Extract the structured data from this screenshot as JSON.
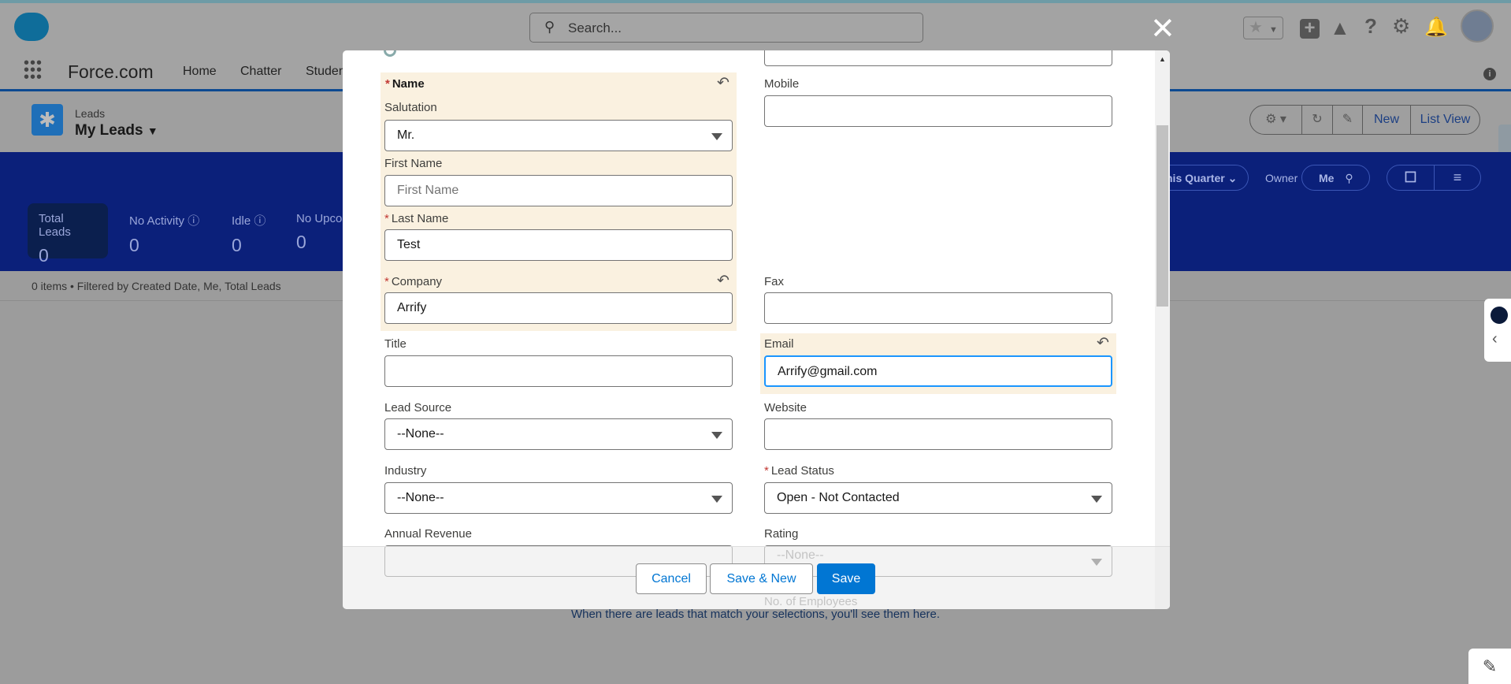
{
  "header": {
    "search_placeholder": "Search...",
    "app_name": "Force.com",
    "nav": [
      "Home",
      "Chatter",
      "Studen"
    ]
  },
  "page": {
    "object": "Leads",
    "list_view": "My Leads",
    "toolbar": {
      "new": "New",
      "list_view": "List View"
    }
  },
  "filters": {
    "period": "his Quarter",
    "owner_label": "Owner",
    "owner_value": "Me"
  },
  "stats": [
    {
      "label": "Total Leads",
      "value": "0"
    },
    {
      "label": "No Activity",
      "value": "0"
    },
    {
      "label": "Idle",
      "value": "0"
    },
    {
      "label": "No Upco",
      "value": "0"
    }
  ],
  "list_info": "0 items • Filtered by Created Date, Me, Total Leads",
  "empty_message": "When there are leads that match your selections, you'll see them here.",
  "form": {
    "name_section": "Name",
    "salutation": {
      "label": "Salutation",
      "value": "Mr."
    },
    "first_name": {
      "label": "First Name",
      "placeholder": "First Name"
    },
    "last_name": {
      "label": "Last Name",
      "value": "Test"
    },
    "company": {
      "label": "Company",
      "value": "Arrify"
    },
    "title": {
      "label": "Title",
      "value": ""
    },
    "lead_source": {
      "label": "Lead Source",
      "value": "--None--"
    },
    "industry": {
      "label": "Industry",
      "value": "--None--"
    },
    "annual_revenue": {
      "label": "Annual Revenue",
      "value": ""
    },
    "mobile": {
      "label": "Mobile",
      "value": ""
    },
    "fax": {
      "label": "Fax",
      "value": ""
    },
    "email": {
      "label": "Email",
      "value": "Arrify@gmail.com"
    },
    "website": {
      "label": "Website",
      "value": ""
    },
    "lead_status": {
      "label": "Lead Status",
      "value": "Open - Not Contacted"
    },
    "rating": {
      "label": "Rating",
      "value": "--None--"
    },
    "employees": {
      "label": "No. of Employees"
    }
  },
  "buttons": {
    "cancel": "Cancel",
    "save_new": "Save & New",
    "save": "Save"
  },
  "colors": {
    "brand_blue": "#0176d3",
    "band": "#0b207a",
    "highlight": "#faf1e0",
    "required": "#c23934"
  }
}
